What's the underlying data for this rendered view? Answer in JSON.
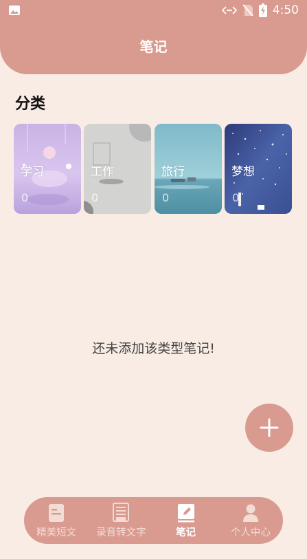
{
  "status_bar": {
    "time": "4:50"
  },
  "header": {
    "title": "笔记"
  },
  "category": {
    "section_title": "分类",
    "cards": [
      {
        "label": "学习",
        "count": "0"
      },
      {
        "label": "工作",
        "count": "0"
      },
      {
        "label": "旅行",
        "count": "0"
      },
      {
        "label": "梦想",
        "count": "0"
      }
    ]
  },
  "empty_message": "还未添加该类型笔记!",
  "bottom_nav": {
    "items": [
      {
        "label": "精美短文",
        "icon": "document-icon"
      },
      {
        "label": "录音转文字",
        "icon": "transcript-icon"
      },
      {
        "label": "笔记",
        "icon": "notebook-pen-icon",
        "active": true
      },
      {
        "label": "个人中心",
        "icon": "person-icon"
      }
    ]
  },
  "colors": {
    "accent": "#d99a8f",
    "background": "#f8ece4"
  }
}
